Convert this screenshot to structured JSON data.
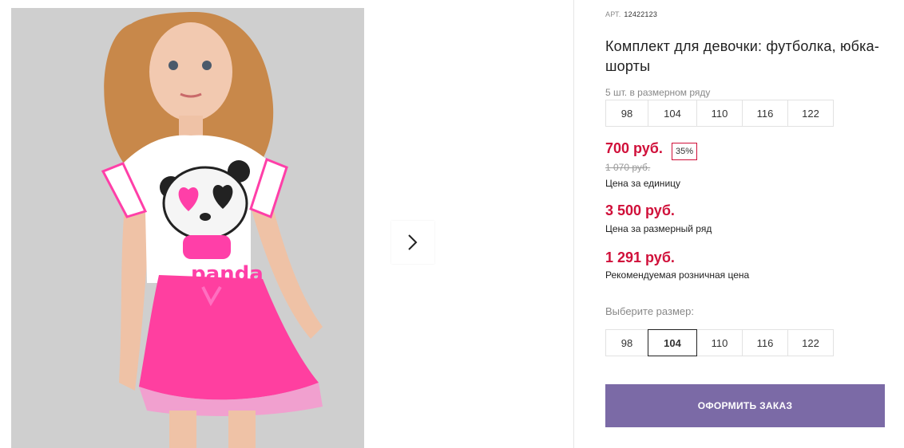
{
  "gallery": {
    "next_icon": "chevron-right-icon"
  },
  "product": {
    "sku_label": "АРТ.",
    "sku_value": "12422123",
    "title": "Комплект для девочки: футболка, юбка-шорты",
    "row_hint": "5 шт. в размерном ряду",
    "row_sizes": [
      "98",
      "104",
      "110",
      "116",
      "122"
    ],
    "price": "700 руб.",
    "discount": "35%",
    "old_price": "1 070 руб.",
    "unit_label": "Цена за единицу",
    "row_price": "3 500 руб.",
    "row_price_label": "Цена за размерный ряд",
    "retail_price": "1 291 руб.",
    "retail_label": "Рекомендуемая розничная цена",
    "choose_label": "Выберите размер:",
    "sizes": [
      "98",
      "104",
      "110",
      "116",
      "122"
    ],
    "selected_size": "104",
    "order_button": "ОФОРМИТЬ ЗАКАЗ"
  },
  "colors": {
    "price": "#d0103a",
    "button": "#7b6aa6"
  }
}
